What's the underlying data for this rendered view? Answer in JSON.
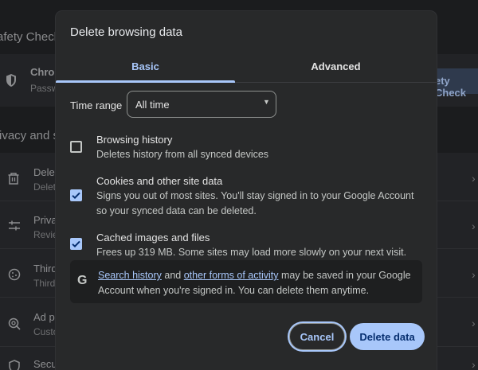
{
  "background": {
    "section1_title": "afety Check",
    "card1_title": "Chron",
    "card1_sub": "Passw",
    "safety_button": "ety Check",
    "section2_title": "rivacy and s",
    "rows": [
      {
        "title": "Delet",
        "sub": "Delet",
        "icon": "trash-icon"
      },
      {
        "title": "Priva",
        "sub": "Revie",
        "icon": "tune-icon"
      },
      {
        "title": "Third",
        "sub": "Third",
        "icon": "cookie-icon"
      },
      {
        "title": "Ad p",
        "sub": "Custo",
        "icon": "ad-privacy-icon"
      },
      {
        "title": "Secu",
        "sub": "",
        "icon": "security-icon"
      }
    ]
  },
  "dialog": {
    "title": "Delete browsing data",
    "tabs": [
      {
        "label": "Basic",
        "active": true
      },
      {
        "label": "Advanced",
        "active": false
      }
    ],
    "time_range": {
      "label": "Time range",
      "value": "All time"
    },
    "options": [
      {
        "title": "Browsing history",
        "description": "Deletes history from all synced devices",
        "checked": false
      },
      {
        "title": "Cookies and other site data",
        "description": "Signs you out of most sites. You'll stay signed in to your Google Account so your synced data can be deleted.",
        "checked": true
      },
      {
        "title": "Cached images and files",
        "description": "Frees up 319 MB. Some sites may load more slowly on your next visit.",
        "checked": true
      }
    ],
    "info": {
      "icon": "google-g-icon",
      "link1": "Search history",
      "text1": " and ",
      "link2": "other forms of activity",
      "text2": " may be saved in your Google Account when you're signed in. You can delete them anytime."
    },
    "buttons": {
      "cancel": "Cancel",
      "delete": "Delete data"
    }
  },
  "colors": {
    "accent": "#a8c7fa",
    "dialog_bg": "#28292a",
    "page_bg": "#1b1c1e"
  }
}
